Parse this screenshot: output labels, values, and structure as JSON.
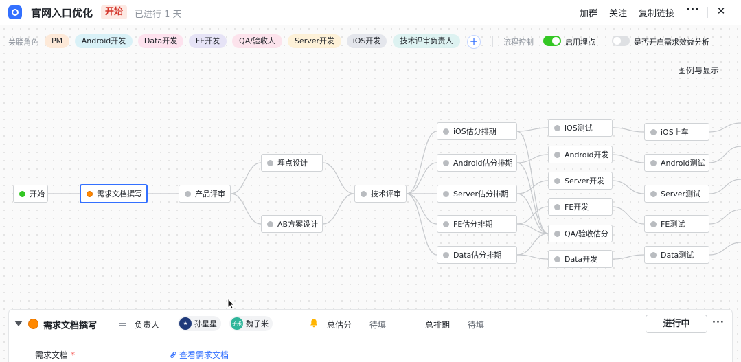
{
  "header": {
    "title": "官网入口优化",
    "status": "开始",
    "elapsed": "已进行 1 天",
    "actions": {
      "join_group": "加群",
      "follow": "关注",
      "copy_link": "复制链接",
      "more": "···",
      "close": "✕"
    }
  },
  "role_bar": {
    "label": "关联角色",
    "roles": [
      {
        "label": "PM",
        "color": "#fde9d8"
      },
      {
        "label": "Android开发",
        "color": "#d9f1f7"
      },
      {
        "label": "Data开发",
        "color": "#fde2ee"
      },
      {
        "label": "FE开发",
        "color": "#e6e3f6"
      },
      {
        "label": "QA/验收人",
        "color": "#fce3ec"
      },
      {
        "label": "Server开发",
        "color": "#fdf1d8"
      },
      {
        "label": "iOS开发",
        "color": "#e4e6ec"
      },
      {
        "label": "技术评审负责人",
        "color": "#ddf2f1"
      }
    ],
    "add_label": "+",
    "flow_control_label": "流程控制",
    "toggles": [
      {
        "label": "启用埋点",
        "on": true
      },
      {
        "label": "是否开启需求效益分析",
        "on": false
      }
    ],
    "legend_link": "图例与显示"
  },
  "flow": {
    "nodes": {
      "start": "开始",
      "req_doc": "需求文档撰写",
      "product_review": "产品评审",
      "tracking_design": "埋点设计",
      "ab_design": "AB方案设计",
      "tech_review": "技术评审",
      "ios_est": "iOS估分排期",
      "android_est": "Android估分排期",
      "server_est": "Server估分排期",
      "fe_est": "FE估分排期",
      "data_est": "Data估分排期",
      "ios_test": "iOS测试",
      "android_dev": "Android开发",
      "server_dev": "Server开发",
      "fe_dev": "FE开发",
      "qa_est": "QA/验收估分",
      "data_dev": "Data开发",
      "ios_launch": "iOS上车",
      "android_test": "Android测试",
      "server_test": "Server测试",
      "fe_test": "FE测试",
      "data_test": "Data测试"
    }
  },
  "panel": {
    "title": "需求文档撰写",
    "owner_label": "负责人",
    "assignees": [
      {
        "name": "孙星星",
        "avatar_text": "★",
        "color": "#1f3a7a"
      },
      {
        "name": "魏子米",
        "avatar_text": "子米",
        "color": "#2fb59a"
      }
    ],
    "total_estimate_label": "总估分",
    "total_estimate_value": "待填",
    "total_schedule_label": "总排期",
    "total_schedule_value": "待填",
    "status_button": "进行中",
    "more": "···",
    "doc_label": "需求文档",
    "required_mark": "*",
    "doc_link": "查看需求文档"
  }
}
